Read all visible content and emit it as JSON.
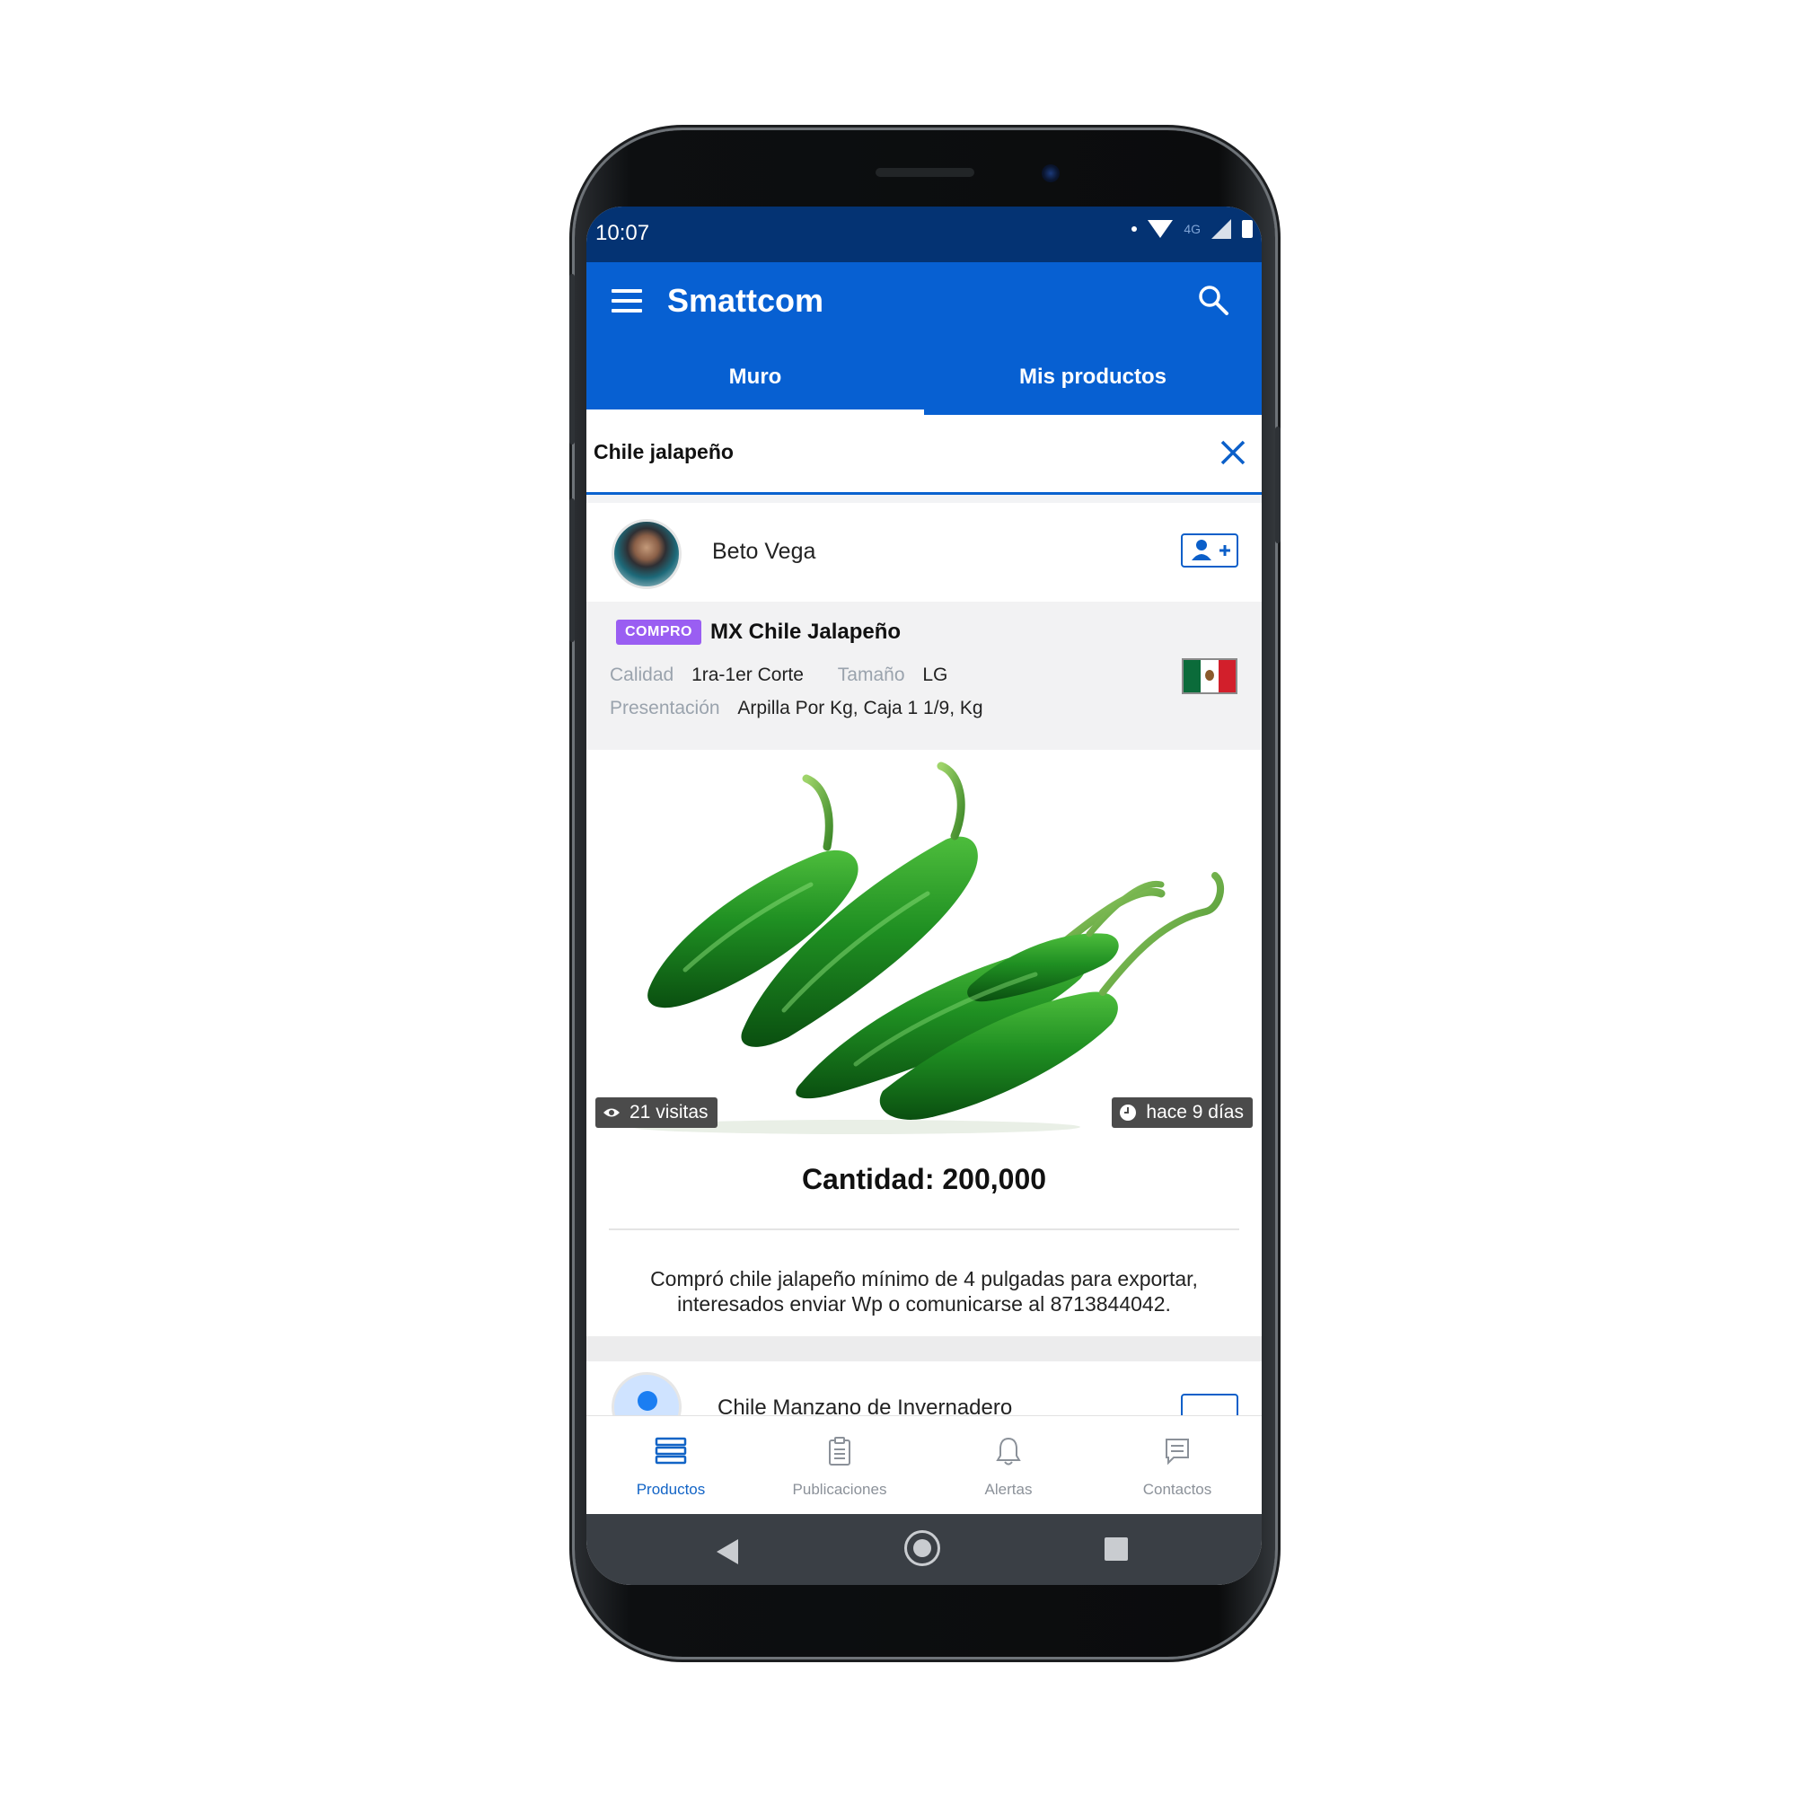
{
  "status": {
    "time": "10:07",
    "network": "4G"
  },
  "app": {
    "title": "Smattcom"
  },
  "tabs": [
    {
      "label": "Muro",
      "active": true
    },
    {
      "label": "Mis productos",
      "active": false
    }
  ],
  "search": {
    "value": "Chile jalapeño"
  },
  "post": {
    "user": "Beto Vega",
    "badge": "COMPRO",
    "title": "MX Chile Jalapeño",
    "attributes": {
      "calidad_label": "Calidad",
      "calidad_value": "1ra-1er Corte",
      "tamano_label": "Tamaño",
      "tamano_value": "LG",
      "presentacion_label": "Presentación",
      "presentacion_value": "Arpilla Por Kg, Caja 1 1/9, Kg"
    },
    "visits": "21 visitas",
    "age": "hace 9 días",
    "quantity": "Cantidad: 200,000",
    "description": "Compró chile jalapeño mínimo de 4 pulgadas para exportar, interesados enviar Wp o comunicarse al 8713844042."
  },
  "next_post": {
    "title": "Chile Manzano de Invernadero"
  },
  "bottom_nav": [
    {
      "label": "Productos",
      "icon": "products-icon",
      "active": true
    },
    {
      "label": "Publicaciones",
      "icon": "clipboard-icon",
      "active": false
    },
    {
      "label": "Alertas",
      "icon": "bell-icon",
      "active": false
    },
    {
      "label": "Contactos",
      "icon": "contacts-icon",
      "active": false
    }
  ],
  "colors": {
    "primary": "#0760d2",
    "statusbar": "#043373",
    "badge": "#9a5ef2"
  }
}
